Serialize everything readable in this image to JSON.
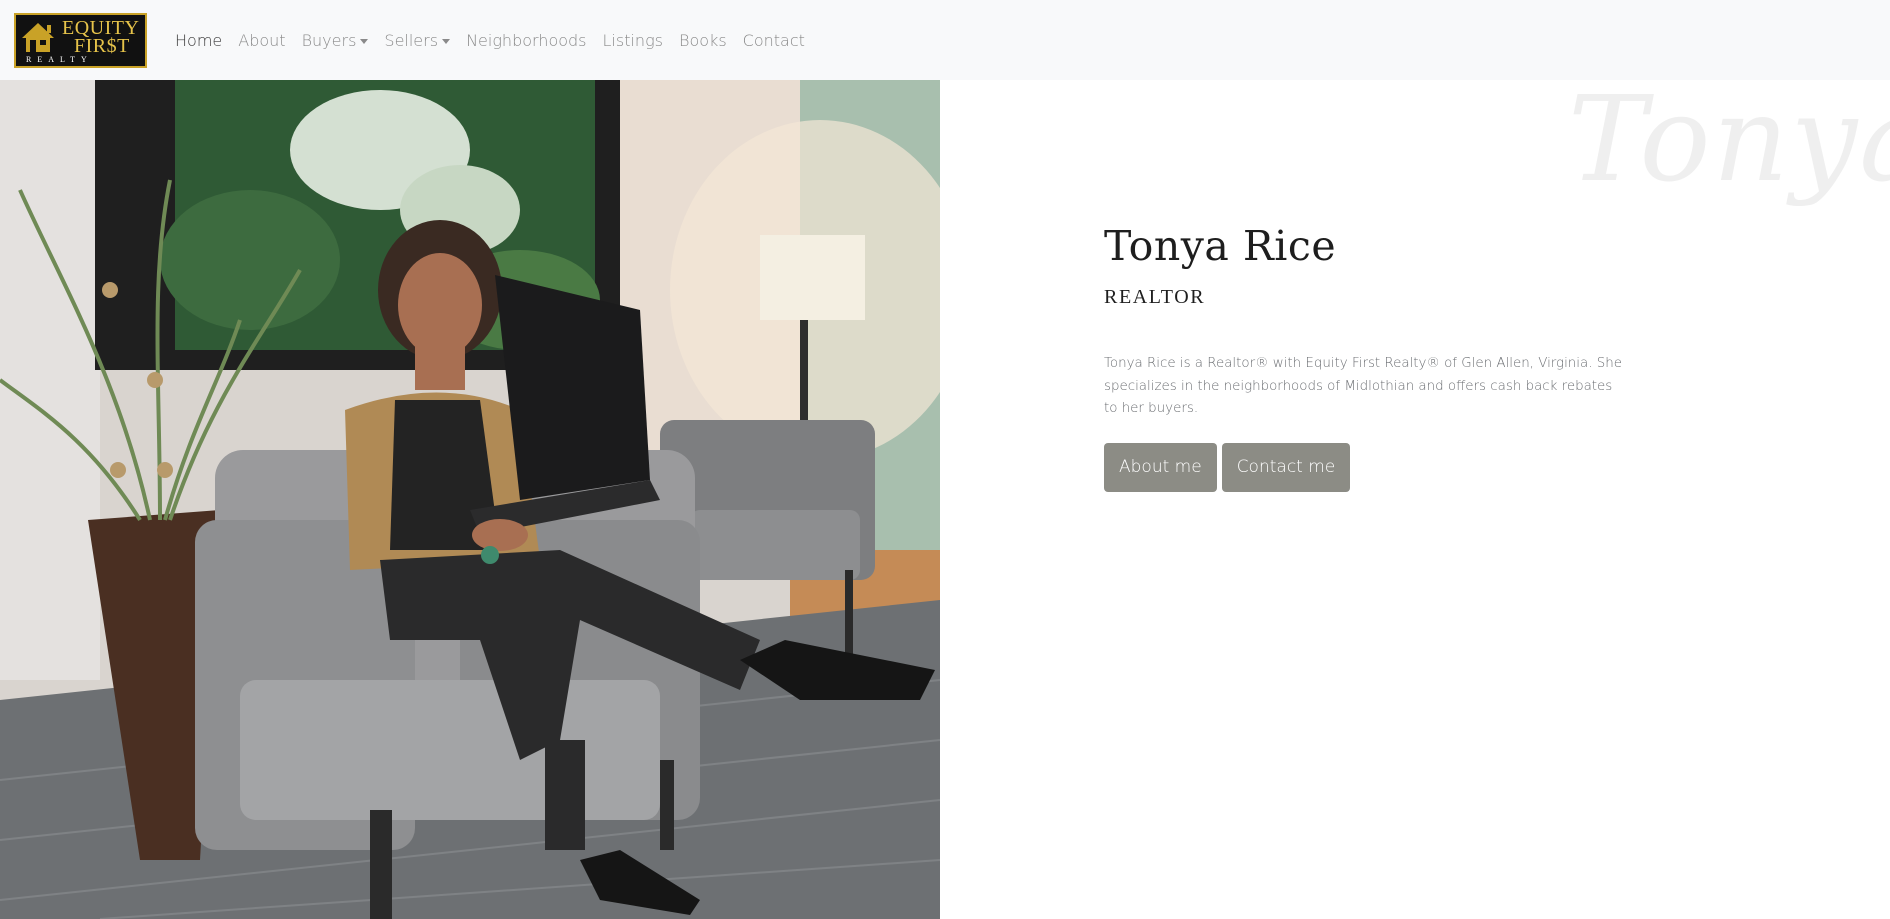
{
  "brand": {
    "logo_line1": "EQUITY",
    "logo_line2": "FIR$T",
    "logo_line3": "REALTY",
    "colors": {
      "gold": "#e6c34a",
      "logo_bg": "#111111"
    }
  },
  "nav": {
    "items": [
      {
        "label": "Home",
        "active": true,
        "dropdown": false
      },
      {
        "label": "About",
        "active": false,
        "dropdown": false
      },
      {
        "label": "Buyers",
        "active": false,
        "dropdown": true
      },
      {
        "label": "Sellers",
        "active": false,
        "dropdown": true
      },
      {
        "label": "Neighborhoods",
        "active": false,
        "dropdown": false
      },
      {
        "label": "Listings",
        "active": false,
        "dropdown": false
      },
      {
        "label": "Books",
        "active": false,
        "dropdown": false
      },
      {
        "label": "Contact",
        "active": false,
        "dropdown": false
      }
    ]
  },
  "hero": {
    "photo_icon": "realtor-portrait-photo"
  },
  "profile": {
    "watermark": "Tonya",
    "name": "Tonya Rice",
    "title": "REALTOR",
    "bio": "Tonya Rice is a Realtor® with Equity First Realty® of Glen Allen, Virginia. She specializes in the neighborhoods of Midlothian and offers cash back rebates to her buyers.",
    "buttons": {
      "about": "About me",
      "contact": "Contact me"
    },
    "colors": {
      "button_bg": "#8c8c85",
      "bio_text": "#6c6f73"
    }
  }
}
